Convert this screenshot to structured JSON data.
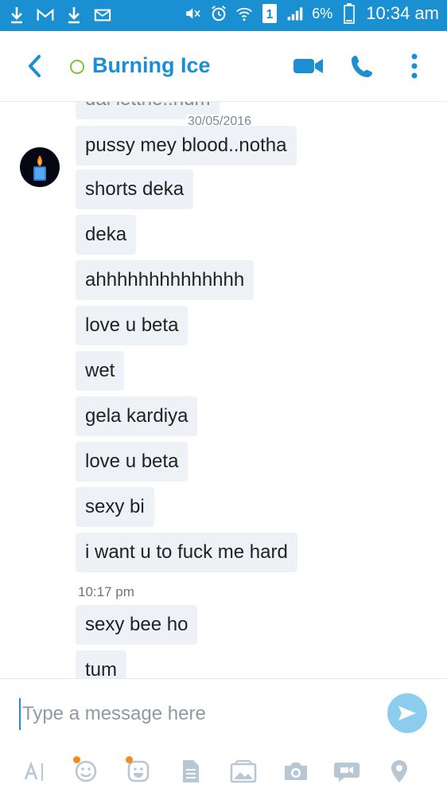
{
  "status_bar": {
    "battery": "6%",
    "sim_slot": "1",
    "time": "10:34 am"
  },
  "header": {
    "contact_name": "Burning Ice"
  },
  "chat": {
    "date_separator": "30/05/2016",
    "timestamp": "10:17 pm",
    "messages": [
      {
        "text": "dai letthe..hum"
      },
      {
        "text": "pussy mey blood..notha"
      },
      {
        "text": "shorts deka"
      },
      {
        "text": "deka"
      },
      {
        "text": "ahhhhhhhhhhhhhh"
      },
      {
        "text": "love u beta"
      },
      {
        "text": "wet"
      },
      {
        "text": "gela kardiya"
      },
      {
        "text": "love u beta"
      },
      {
        "text": "sexy bi"
      },
      {
        "text": "i want u to fuck me hard"
      },
      {
        "text": "sexy bee ho"
      },
      {
        "text": "tum"
      }
    ]
  },
  "compose": {
    "placeholder": "Type a message here"
  },
  "colors": {
    "brand": "#1a8fd1",
    "presence": "#7cc23b",
    "bubble": "#eef1f5",
    "send_button": "#8ccdee",
    "notification": "#f28c1f"
  }
}
